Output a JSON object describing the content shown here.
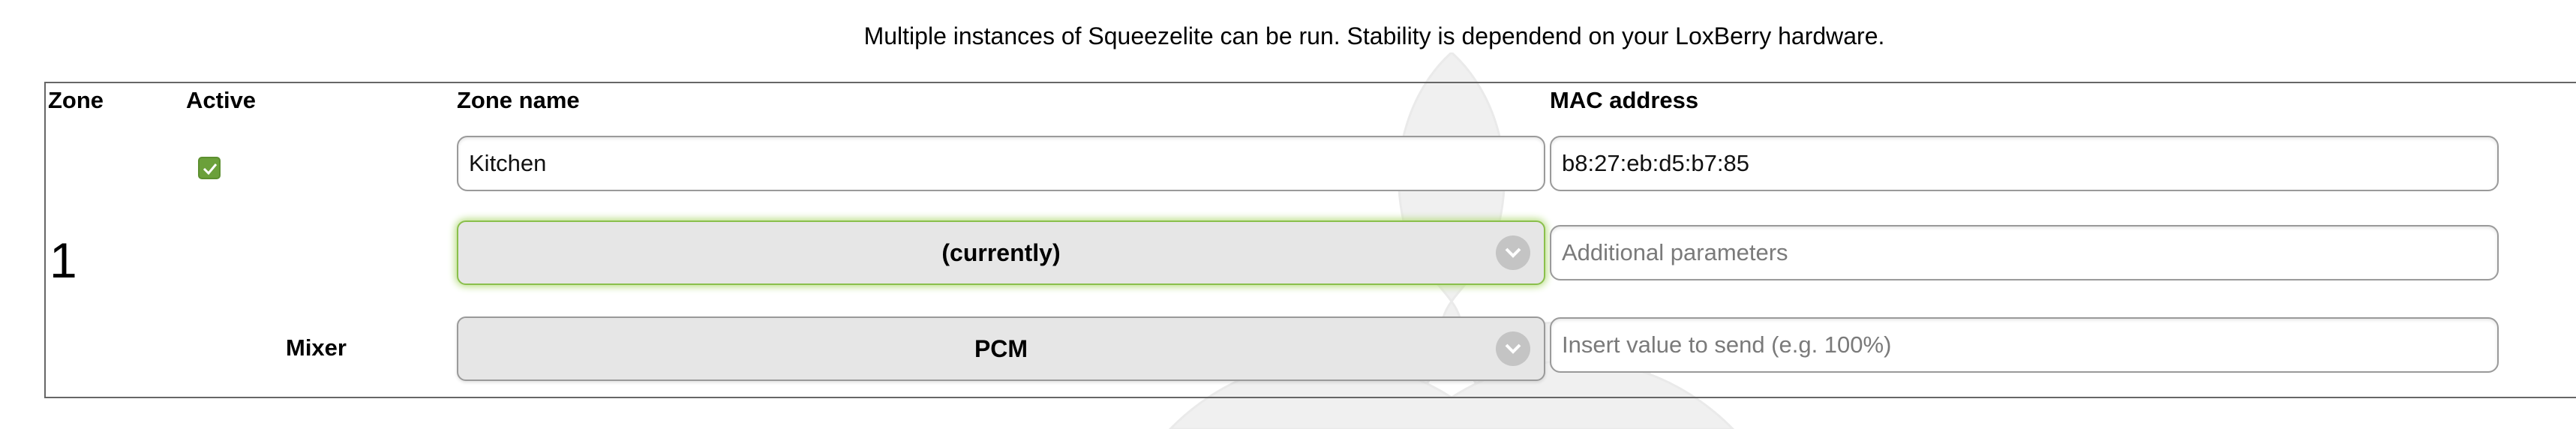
{
  "info_text": "Multiple instances of Squeezelite can be run. Stability is dependend on your LoxBerry hardware.",
  "headers": {
    "zone": "Zone",
    "active": "Active",
    "zone_name": "Zone name",
    "mac_address": "MAC address"
  },
  "zone": {
    "number": "1",
    "active": true,
    "name": "Kitchen",
    "mac": "b8:27:eb:d5:b7:85",
    "output_device": "(currently)",
    "additional_params_placeholder": "Additional parameters",
    "mixer_label": "Mixer",
    "mixer": "PCM",
    "mixer_value_placeholder": "Insert value to send (e.g. 100%)"
  },
  "colors": {
    "checkbox": "#6ba03a",
    "focus_glow": "#b6dc80",
    "select_bg": "#e6e6e6"
  },
  "icons": [
    "check-icon",
    "chevron-down-icon",
    "loxberry-watermark"
  ]
}
